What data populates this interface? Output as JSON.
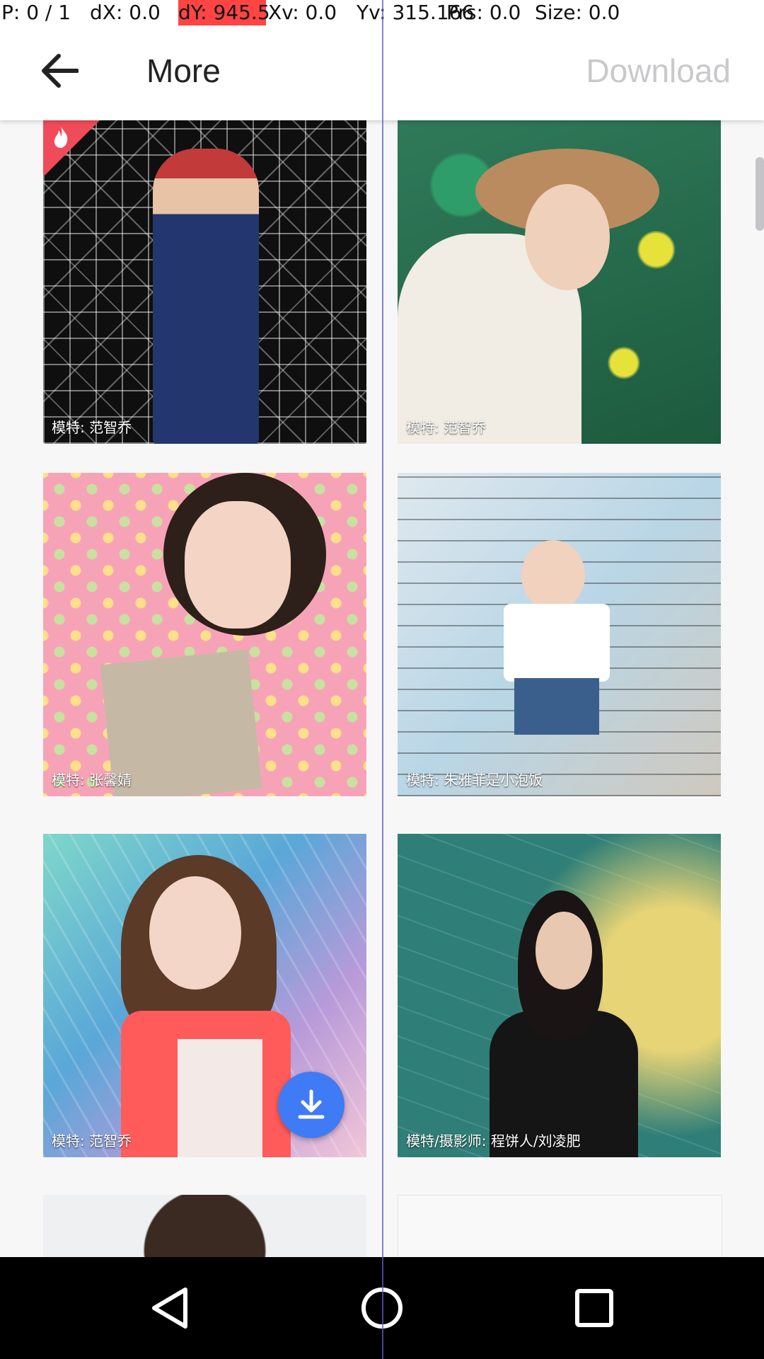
{
  "debug": {
    "p": "P: 0 / 1",
    "dx": "dX: 0.0",
    "dy": "dY: 945.5",
    "xv": "Xv: 0.0",
    "yv": "Yv: 315.166",
    "prs": "Prs: 0.0",
    "size": "Size: 0.0"
  },
  "appbar": {
    "back_icon": "arrow-left-icon",
    "title": "More",
    "download_label": "Download"
  },
  "grid": {
    "cards": [
      {
        "caption": "模特: 范智乔",
        "hot": true
      },
      {
        "caption": "模特: 范智乔",
        "hot": false
      },
      {
        "caption": "模特: 张馨婧",
        "hot": false
      },
      {
        "caption": "模特: 朱雅菲是小泡饭",
        "hot": false
      },
      {
        "caption": "模特: 范智乔",
        "hot": false,
        "download_icon": "download-icon"
      },
      {
        "caption": "模特/摄影师: 程饼人/刘凌肥",
        "hot": false
      }
    ]
  },
  "colors": {
    "accent": "#3f7bf4",
    "hot_badge": "#f04b5a",
    "debug_highlight": "#ff4444",
    "download_disabled": "#c9c9cc"
  },
  "navbar": {
    "icons": [
      "back-triangle-icon",
      "home-circle-icon",
      "recents-square-icon"
    ]
  }
}
